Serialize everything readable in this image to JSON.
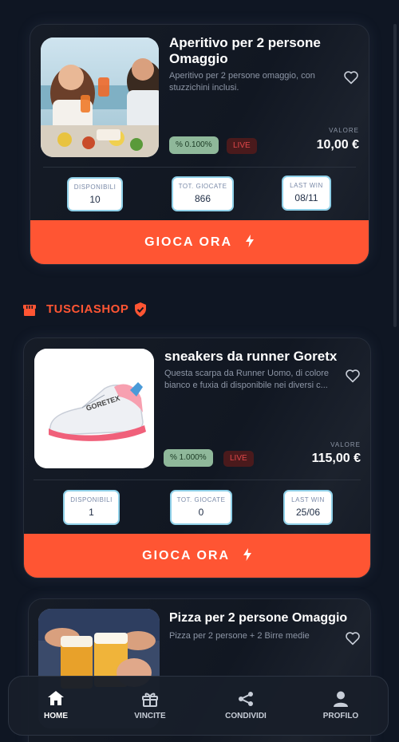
{
  "shop": {
    "name": "TUSCIASHOP"
  },
  "products": [
    {
      "title": "Aperitivo per 2 persone Omaggio",
      "description": "Aperitivo per 2 persone omaggio, con stuzzichini inclusi.",
      "percent": "% 0.100%",
      "live": "LIVE",
      "value_label": "VALORE",
      "value": "10,00 €",
      "stats": [
        {
          "label": "DISPONIBILI",
          "value": "10"
        },
        {
          "label": "TOT. GIOCATE",
          "value": "866"
        },
        {
          "label": "LAST WIN",
          "value": "08/11"
        }
      ],
      "cta": "GIOCA ORA"
    },
    {
      "title": "sneakers da runner Goretx",
      "description": "Questa scarpa da Runner Uomo, di colore bianco e fuxia di  disponibile nei diversi c...",
      "percent": "% 1.000%",
      "live": "LIVE",
      "value_label": "VALORE",
      "value": "115,00 €",
      "stats": [
        {
          "label": "DISPONIBILI",
          "value": "1"
        },
        {
          "label": "TOT. GIOCATE",
          "value": "0"
        },
        {
          "label": "LAST WIN",
          "value": "25/06"
        }
      ],
      "cta": "GIOCA ORA"
    },
    {
      "title": "Pizza per 2 persone Omaggio",
      "description": "Pizza per 2 persone + 2 Birre medie"
    }
  ],
  "nav": [
    {
      "label": "HOME",
      "icon": "home-icon",
      "active": true
    },
    {
      "label": "VINCITE",
      "icon": "gift-icon",
      "active": false
    },
    {
      "label": "CONDIVIDI",
      "icon": "share-icon",
      "active": false
    },
    {
      "label": "PROFILO",
      "icon": "user-icon",
      "active": false
    }
  ],
  "colors": {
    "accent": "#ff5533",
    "background": "#0f1623",
    "percent_badge": "#8fb89a",
    "live_badge": "#4a1a1c"
  }
}
